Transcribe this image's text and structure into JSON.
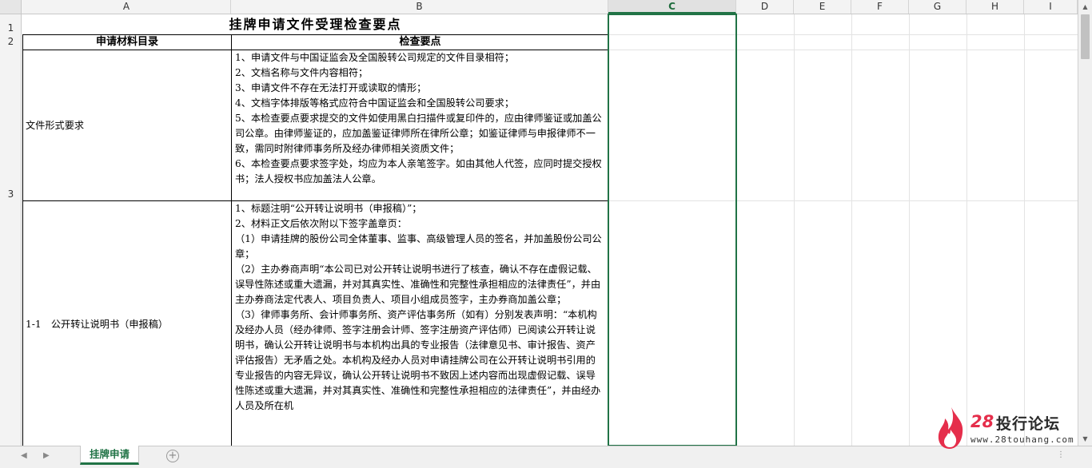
{
  "columns": [
    "A",
    "B",
    "C",
    "D",
    "E",
    "F",
    "G",
    "H",
    "I"
  ],
  "selected_column": "C",
  "rows": [
    "1",
    "2",
    "3"
  ],
  "title": "挂牌申请文件受理检查要点",
  "headers": {
    "a": "申请材料目录",
    "b": "检查要点"
  },
  "row3": {
    "label": "文件形式要求",
    "content": "1、申请文件与中国证监会及全国股转公司规定的文件目录相符；\n2、文档名称与文件内容相符；\n3、申请文件不存在无法打开或读取的情形；\n4、文档字体排版等格式应符合中国证监会和全国股转公司要求；\n5、本检查要点要求提交的文件如使用黑白扫描件或复印件的，应由律师鉴证或加盖公司公章。由律师鉴证的，应加盖鉴证律师所在律所公章；如鉴证律师与申报律师不一致，需同时附律师事务所及经办律师相关资质文件；\n6、本检查要点要求签字处，均应为本人亲笔签字。如由其他人代签，应同时提交授权书；法人授权书应加盖法人公章。"
  },
  "row4": {
    "label": "1-1　公开转让说明书（申报稿）",
    "content": "1、标题注明“公开转让说明书（申报稿）”；\n2、材料正文后依次附以下签字盖章页：\n（1）申请挂牌的股份公司全体董事、监事、高级管理人员的签名，并加盖股份公司公章；\n（2）主办券商声明“本公司已对公开转让说明书进行了核查，确认不存在虚假记载、误导性陈述或重大遗漏，并对其真实性、准确性和完整性承担相应的法律责任”，并由主办券商法定代表人、项目负责人、项目小组成员签字，主办券商加盖公章；\n（3）律师事务所、会计师事务所、资产评估事务所（如有）分别发表声明：“本机构及经办人员（经办律师、签字注册会计师、签字注册资产评估师）已阅读公开转让说明书，确认公开转让说明书与本机构出具的专业报告（法律意见书、审计报告、资产评估报告）无矛盾之处。本机构及经办人员对申请挂牌公司在公开转让说明书引用的专业报告的内容无异议，确认公开转让说明书不致因上述内容而出现虚假记载、误导性陈述或重大遗漏，并对其真实性、准确性和完整性承担相应的法律责任”，并由经办人员及所在机"
  },
  "sheet_tab": "挂牌申请",
  "logo": {
    "num": "28",
    "cn": "投行论坛",
    "url": "www.28touhang.com",
    "color": "#e52e4b"
  }
}
